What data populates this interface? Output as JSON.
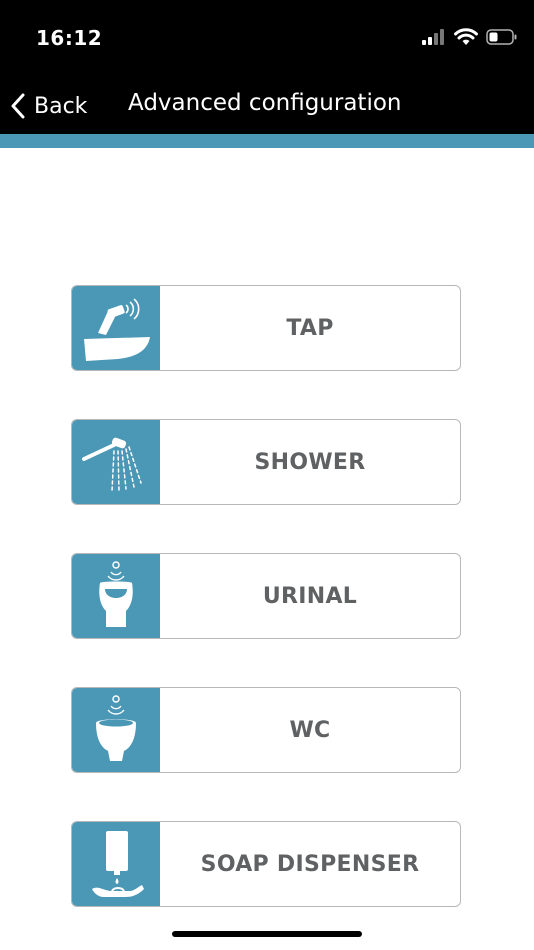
{
  "status_bar": {
    "time": "16:12"
  },
  "nav": {
    "back_label": "Back",
    "title": "Advanced configuration"
  },
  "colors": {
    "accent": "#4a97b6",
    "nav_background": "#000000",
    "label_text": "#5f6163"
  },
  "menu": {
    "items": [
      {
        "label": "TAP",
        "icon": "tap-icon"
      },
      {
        "label": "SHOWER",
        "icon": "shower-icon"
      },
      {
        "label": "URINAL",
        "icon": "urinal-icon"
      },
      {
        "label": "WC",
        "icon": "wc-icon"
      },
      {
        "label": "SOAP DISPENSER",
        "icon": "soap-dispenser-icon"
      }
    ]
  }
}
